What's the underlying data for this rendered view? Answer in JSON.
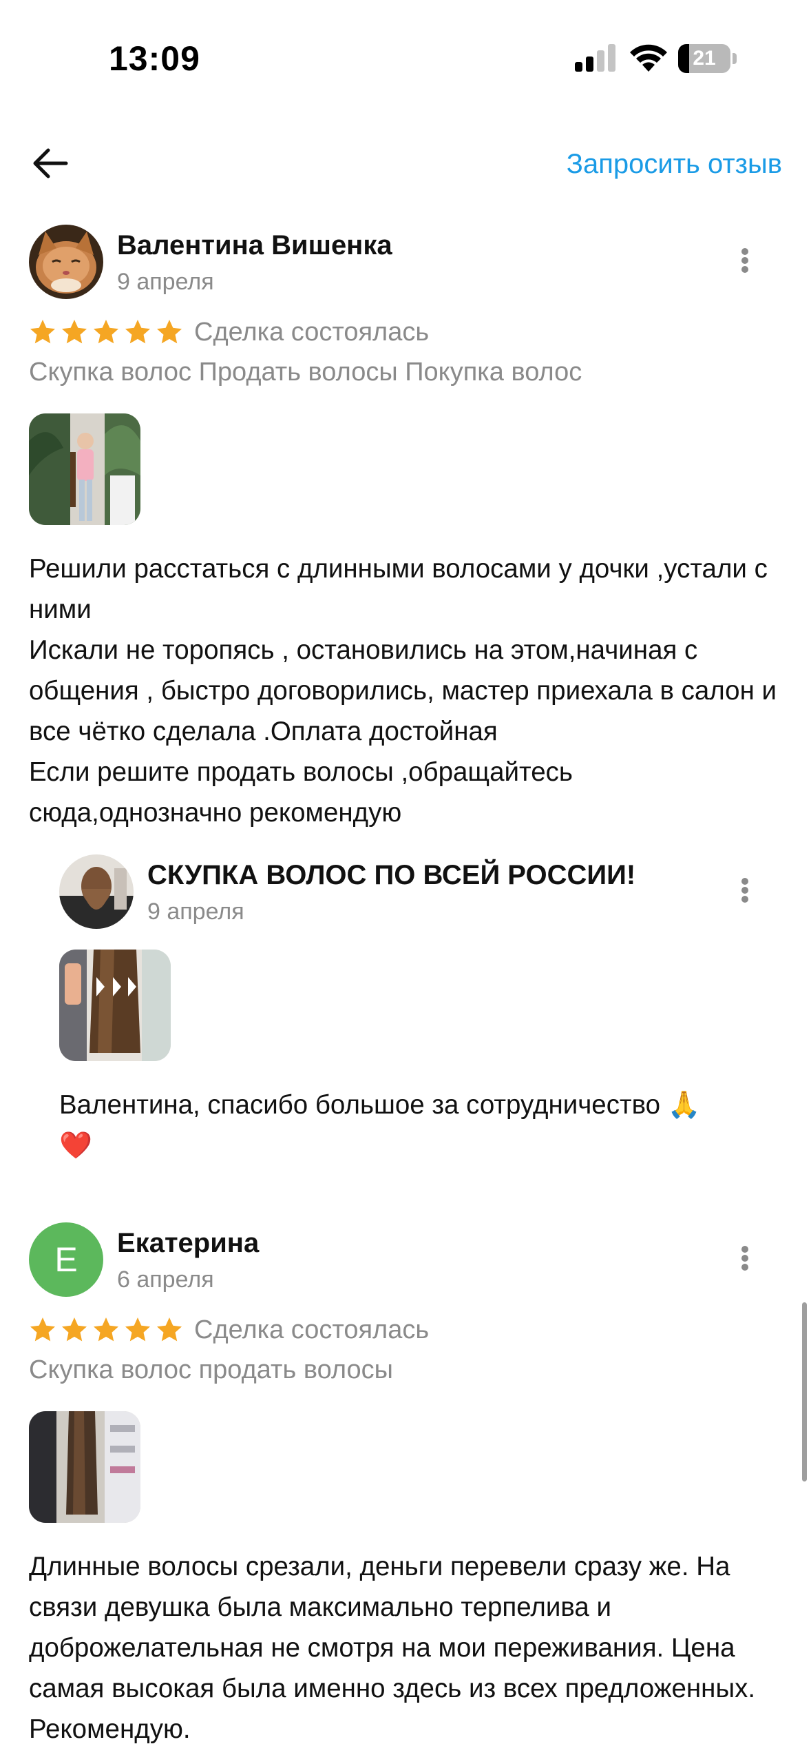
{
  "status_bar": {
    "time": "13:09",
    "battery": "21",
    "battery_level": 0.21,
    "signal_bars": 2,
    "icons": [
      "cellular-signal-icon",
      "wifi-icon",
      "battery-icon"
    ]
  },
  "header": {
    "back_icon": "arrow-left-icon",
    "request_review_label": "Запросить отзыв"
  },
  "colors": {
    "accent": "#1a9be6",
    "star": "#f5a623",
    "muted_text": "#8a8a8a",
    "avatar_green": "#5cb85c"
  },
  "reviews": [
    {
      "author": "Валентина Вишенка",
      "date": "9 апреля",
      "rating": 5,
      "deal_status": "Сделка состоялась",
      "tags": "Скупка волос Продать волосы Покупка волос",
      "text": "Решили расстаться с длинными волосами у дочки ,устали с ними\nИскали не торопясь , остановились на этом,начиная с общения , быстро договорились, мастер приехала в салон и все чётко сделала .Оплата достойная\nЕсли решите продать волосы ,обращайтесь сюда,однозначно рекомендую",
      "reply": {
        "author": "СКУПКА ВОЛОС ПО ВСЕЙ РОССИИ!",
        "date": "9 апреля",
        "text": "Валентина, спасибо большое за сотрудничество 🙏\n❤️"
      }
    },
    {
      "author": "Екатерина",
      "avatar_letter": "Е",
      "date": "6 апреля",
      "rating": 5,
      "deal_status": "Сделка состоялась",
      "tags": "Скупка волос продать волосы",
      "text": "Длинные волосы срезали, деньги перевели сразу же. На связи девушка была максимально терпелива и доброжелательная не смотря на мои переживания. Цена самая высокая была именно здесь из всех предложенных. Рекомендую."
    }
  ]
}
